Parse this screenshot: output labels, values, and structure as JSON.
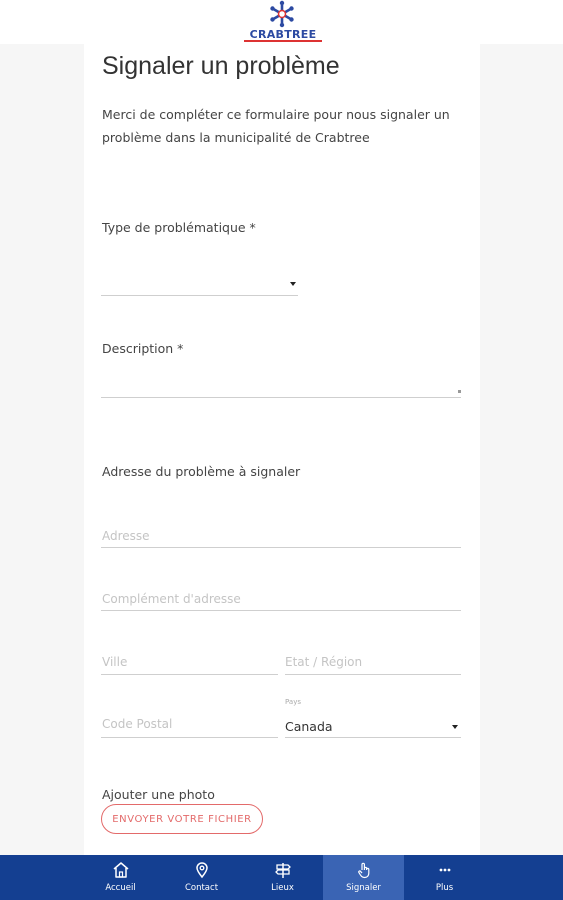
{
  "brand": {
    "logo_text": "CRABTREE"
  },
  "page": {
    "title": "Signaler un problème",
    "intro": "Merci de compléter ce formulaire pour nous signaler un problème dans la municipalité de Crabtree"
  },
  "form": {
    "type_label": "Type de problématique *",
    "description_label": "Description *",
    "address_section_label": "Adresse du problème à signaler",
    "address_placeholder": "Adresse",
    "address_complement_placeholder": "Complément d'adresse",
    "city_placeholder": "Ville",
    "state_placeholder": "Etat / Région",
    "postal_placeholder": "Code Postal",
    "country_label": "Pays",
    "country_value": "Canada",
    "photo_label": "Ajouter une photo",
    "upload_button": "ENVOYER VOTRE FICHIER"
  },
  "nav": {
    "items": [
      {
        "label": "Accueil",
        "icon": "home-icon"
      },
      {
        "label": "Contact",
        "icon": "map-pin-icon"
      },
      {
        "label": "Lieux",
        "icon": "signpost-icon"
      },
      {
        "label": "Signaler",
        "icon": "hand-pointer-icon"
      },
      {
        "label": "Plus",
        "icon": "more-icon"
      }
    ],
    "active_index": 3
  },
  "colors": {
    "nav_bg": "#143f91",
    "nav_active": "#3a64b4",
    "accent_red": "#e36a6a",
    "brand_blue": "#2c4aa2"
  }
}
